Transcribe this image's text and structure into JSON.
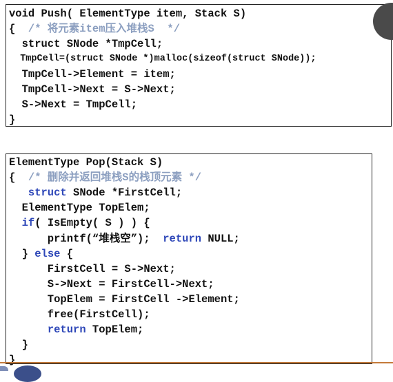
{
  "push": [
    [
      {
        "t": "void Push( ElementType item, Stack S)",
        "c": "plain"
      }
    ],
    [
      {
        "t": "{  ",
        "c": "plain"
      },
      {
        "t": "/* 将元素item压入堆栈S  */",
        "c": "comment"
      }
    ],
    [
      {
        "t": "  struct SNode *TmpCell;",
        "c": "plain"
      }
    ],
    [
      {
        "t": "  TmpCell=(struct SNode *)malloc(sizeof(struct SNode));",
        "c": "plain",
        "small": true
      }
    ],
    [
      {
        "t": "  TmpCell->Element = item;",
        "c": "plain"
      }
    ],
    [
      {
        "t": "  TmpCell->Next = S->Next;",
        "c": "plain"
      }
    ],
    [
      {
        "t": "  S->Next = TmpCell;",
        "c": "plain"
      }
    ],
    [
      {
        "t": "}",
        "c": "plain"
      }
    ]
  ],
  "pop": [
    [
      {
        "t": "ElementType Pop(Stack S)",
        "c": "plain"
      }
    ],
    [
      {
        "t": "{  ",
        "c": "plain"
      },
      {
        "t": "/* 删除并返回堆栈S的栈顶元素 */",
        "c": "comment"
      }
    ],
    [
      {
        "t": "   ",
        "c": "plain"
      },
      {
        "t": "struct",
        "c": "kw"
      },
      {
        "t": " SNode *FirstCell;",
        "c": "plain"
      }
    ],
    [
      {
        "t": "  ElementType TopElem;",
        "c": "plain"
      }
    ],
    [
      {
        "t": "  ",
        "c": "plain"
      },
      {
        "t": "if",
        "c": "kw"
      },
      {
        "t": "( IsEmpty( S ) ) {",
        "c": "plain"
      }
    ],
    [
      {
        "t": "      printf(“堆栈空”);  ",
        "c": "plain"
      },
      {
        "t": "return",
        "c": "kw"
      },
      {
        "t": " NULL;",
        "c": "plain"
      }
    ],
    [
      {
        "t": "  } ",
        "c": "plain"
      },
      {
        "t": "else",
        "c": "kw"
      },
      {
        "t": " {",
        "c": "plain"
      }
    ],
    [
      {
        "t": "      FirstCell = S->Next;",
        "c": "plain"
      }
    ],
    [
      {
        "t": "      S->Next = FirstCell->Next;",
        "c": "plain"
      }
    ],
    [
      {
        "t": "      TopElem = FirstCell ->Element;",
        "c": "plain"
      }
    ],
    [
      {
        "t": "      free(FirstCell);",
        "c": "plain"
      }
    ],
    [
      {
        "t": "      ",
        "c": "plain"
      },
      {
        "t": "return",
        "c": "kw"
      },
      {
        "t": " TopElem;",
        "c": "plain"
      }
    ],
    [
      {
        "t": "  }",
        "c": "plain"
      }
    ],
    [
      {
        "t": "}",
        "c": "plain"
      }
    ]
  ],
  "colors": {
    "comment": "#8c9fc0",
    "keyword": "#2e47b8",
    "text": "#111111",
    "border": "#222222",
    "accent_rule": "#c47a3a"
  }
}
